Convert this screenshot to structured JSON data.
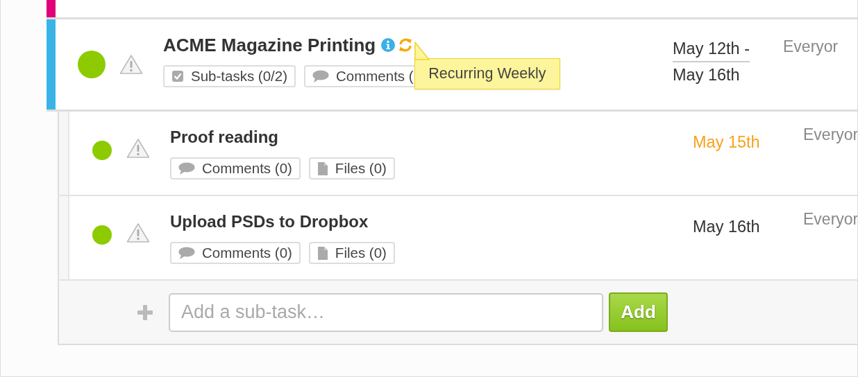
{
  "tasks": [
    {
      "color": "#e2007a"
    },
    {
      "color": "#3ab4e6",
      "status": {
        "color": "#8dcb00"
      },
      "warning": true,
      "title": "ACME Magazine Printing",
      "info": true,
      "recurring": true,
      "tooltip": "Recurring Weekly",
      "badges": [
        {
          "kind": "subtasks",
          "label": "Sub-tasks (0/2)"
        },
        {
          "kind": "comments",
          "label": "Comments ("
        }
      ],
      "dates": [
        "May 12th -",
        "May 16th"
      ],
      "due_soon": false,
      "assignee": "Everyor",
      "subtasks": [
        {
          "status": {
            "color": "#8dcb00"
          },
          "warning": true,
          "title": "Proof reading",
          "badges": [
            {
              "kind": "comments",
              "label": "Comments (0)"
            },
            {
              "kind": "files",
              "label": "Files (0)"
            }
          ],
          "dates": [
            "May 15th"
          ],
          "due_soon": true,
          "assignee": "Everyor"
        },
        {
          "status": {
            "color": "#8dcb00"
          },
          "warning": true,
          "title": "Upload PSDs to Dropbox",
          "badges": [
            {
              "kind": "comments",
              "label": "Comments (0)"
            },
            {
              "kind": "files",
              "label": "Files (0)"
            }
          ],
          "dates": [
            "May 16th"
          ],
          "due_soon": false,
          "assignee": "Everyor"
        }
      ],
      "add_subtask": {
        "placeholder": "Add a sub-task…",
        "button": "Add"
      }
    }
  ]
}
